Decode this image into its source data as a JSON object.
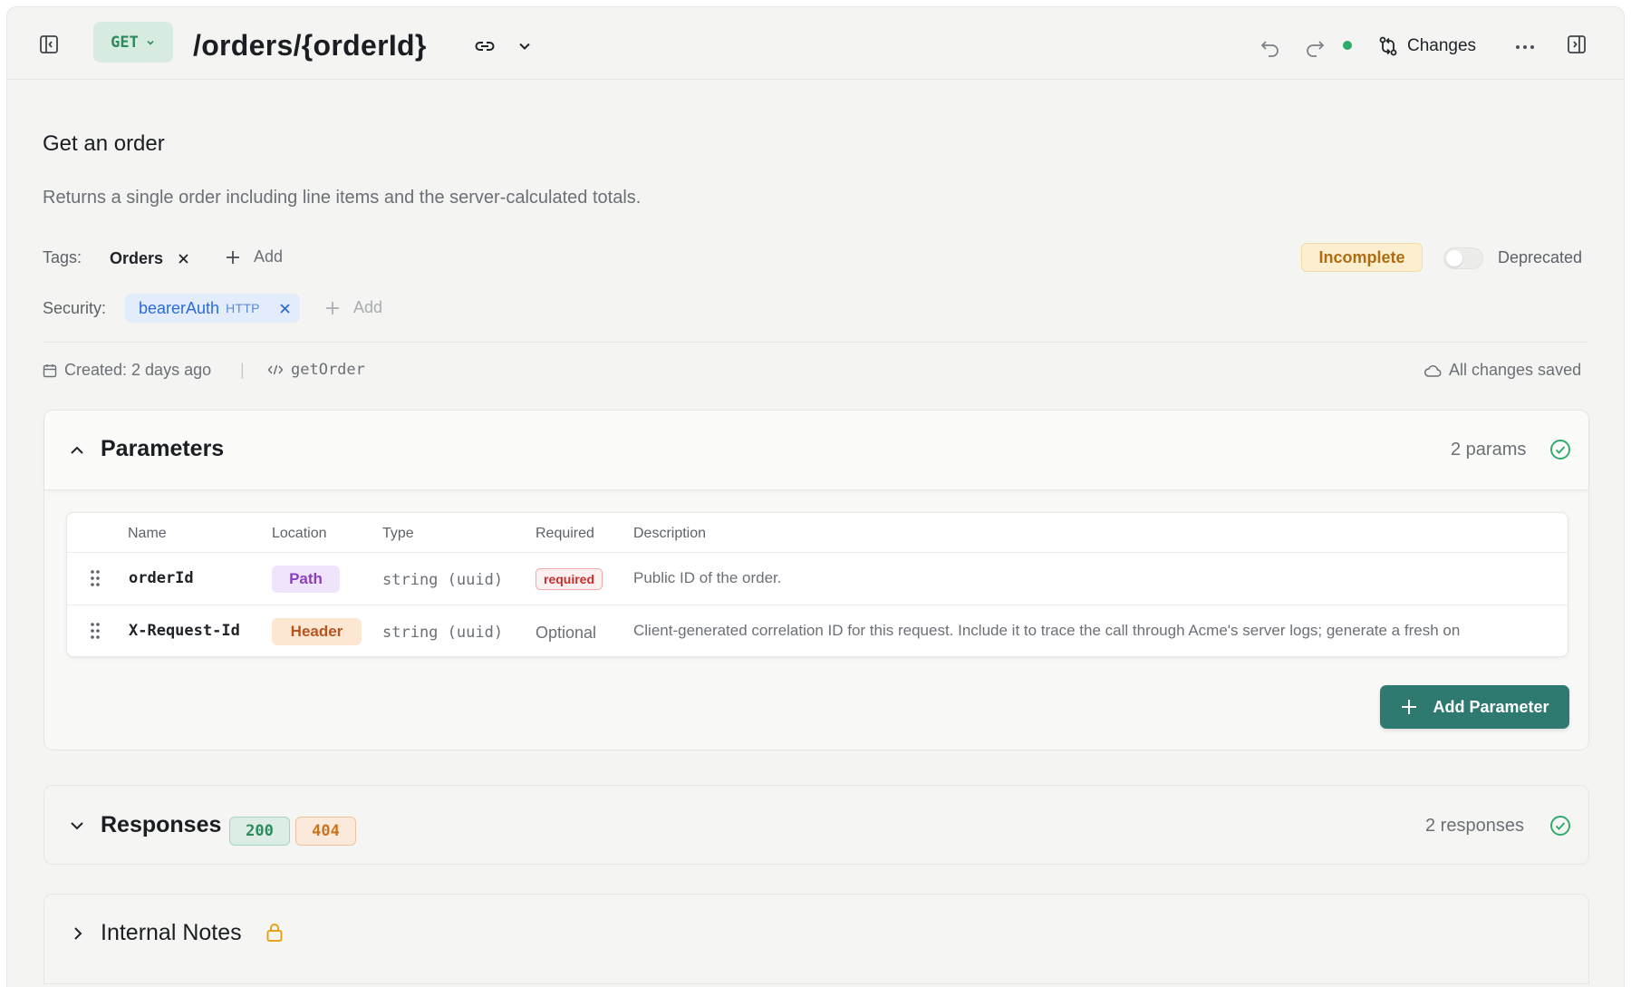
{
  "toolbar": {
    "method": "GET",
    "path": "/orders/{orderId}",
    "changes_label": "Changes"
  },
  "endpoint": {
    "title": "Get an order",
    "description": "Returns a single order including line items and the server-calculated totals."
  },
  "tags": {
    "label": "Tags:",
    "items": [
      "Orders"
    ],
    "add_label": "Add"
  },
  "status": {
    "badge": "Incomplete",
    "deprecated_label": "Deprecated",
    "deprecated": false
  },
  "security": {
    "label": "Security:",
    "scheme_name": "bearerAuth",
    "scheme_type": "HTTP",
    "add_label": "Add"
  },
  "meta": {
    "created": "Created: 2 days ago",
    "separator": "|",
    "operation_id": "getOrder",
    "save_status": "All changes saved"
  },
  "parameters": {
    "title": "Parameters",
    "count": "2 params",
    "columns": [
      "Name",
      "Location",
      "Type",
      "Required",
      "Description"
    ],
    "rows": [
      {
        "name": "orderId",
        "location": "Path",
        "type": "string (uuid)",
        "required": "required",
        "description": "Public ID of the order."
      },
      {
        "name": "X-Request-Id",
        "location": "Header",
        "type": "string (uuid)",
        "required": "Optional",
        "description": "Client-generated correlation ID for this request. Include it to trace the call through Acme's server logs; generate a fresh on"
      }
    ],
    "add_button": "Add Parameter"
  },
  "responses": {
    "title": "Responses",
    "codes": [
      "200",
      "404"
    ],
    "count": "2 responses"
  },
  "notes": {
    "title": "Internal Notes"
  },
  "colors": {
    "accent": "#2e7a70",
    "get_method": "#2e8a5c",
    "success": "#2eaa6a",
    "warning": "#b06c12",
    "error": "#c72f2f",
    "path_location": "#8a3fbf",
    "header_location": "#b7551e"
  }
}
